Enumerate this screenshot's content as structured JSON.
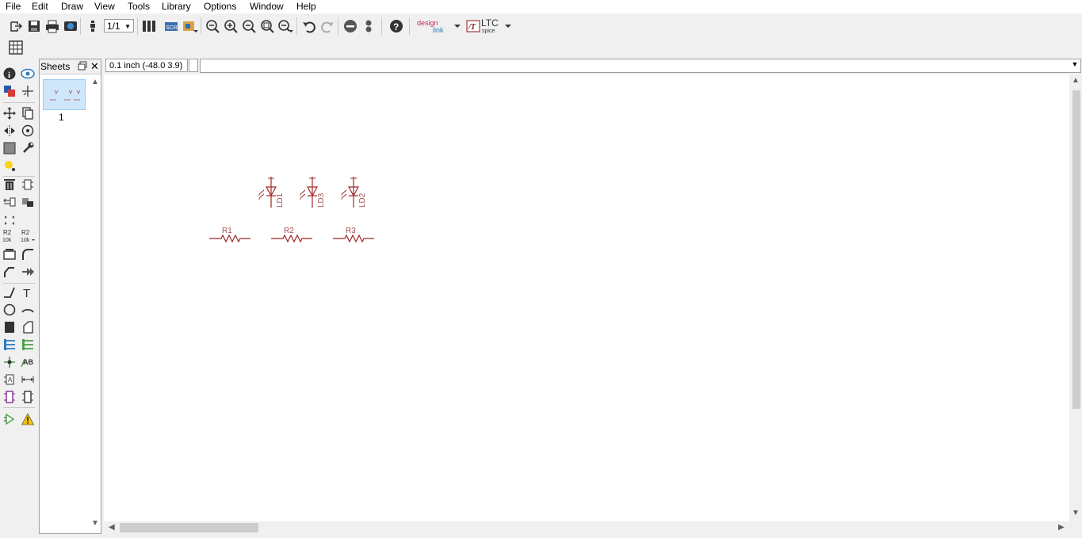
{
  "menu": [
    "File",
    "Edit",
    "Draw",
    "View",
    "Tools",
    "Library",
    "Options",
    "Window",
    "Help"
  ],
  "toolbar": {
    "sheet_selector": "1/1",
    "designlink_logo_top": "design",
    "designlink_logo_bottom": "link",
    "ltc_logo_top": "LTC",
    "ltc_logo_bottom": "spice"
  },
  "palette": {
    "value_tool_top": "R2",
    "value_tool_bottom": "10k",
    "value_tool2_top": "R2",
    "value_tool2_bottom": "10k",
    "text_tool": "T",
    "attribute_tool": "AB"
  },
  "sheets_panel": {
    "title": "Sheets",
    "sheet_number": "1"
  },
  "statusbar": {
    "coordinate": "0.1 inch (-48.0 3.9)",
    "command_value": ""
  },
  "schematic": {
    "leds": [
      "LD1",
      "LD3",
      "LD2"
    ],
    "resistors": [
      "R1",
      "R2",
      "R3"
    ],
    "component_color": "#a02828"
  },
  "colors": {
    "canvas_bg": "#ffffff",
    "ui_bg": "#f0f0f0",
    "accent_blue": "#1a6dc0"
  }
}
